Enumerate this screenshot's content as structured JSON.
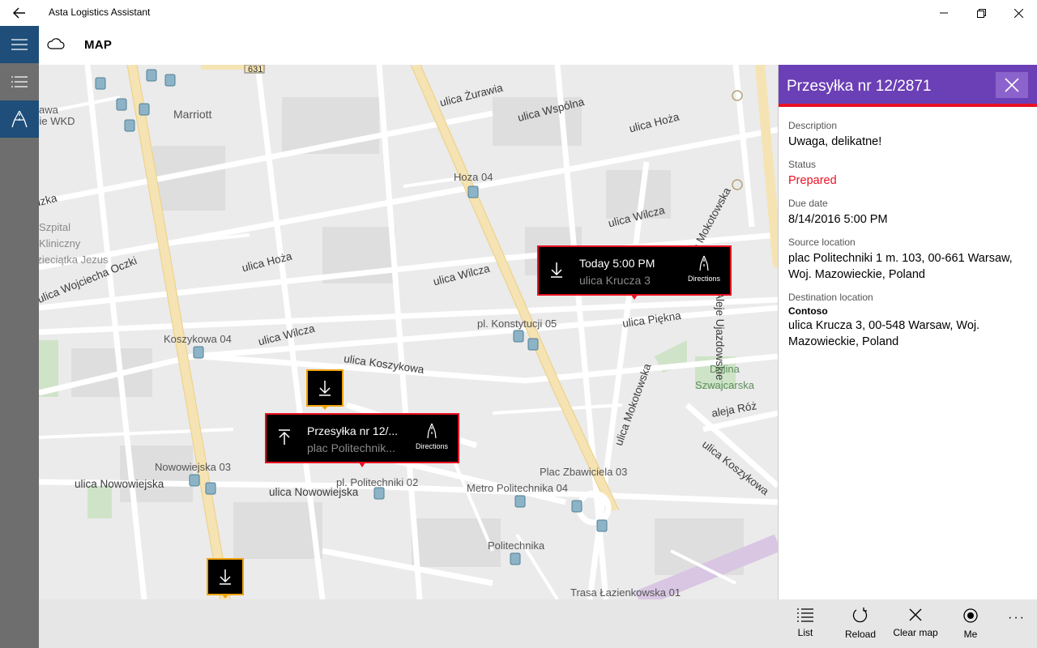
{
  "window": {
    "title": "Asta Logistics Assistant"
  },
  "header": {
    "page_title": "MAP"
  },
  "map": {
    "labels": {
      "marriott": "Marriott",
      "hoza04": "Hoza 04",
      "ulica_zurawia": "ulica Żurawia",
      "ulica_wspolna": "ulica Wspólna",
      "ulica_hoza_right": "ulica Hoża",
      "ulica_wilcza_right": "ulica Wilcza",
      "ulica_hoza_left": "ulica Hoża",
      "ulica_wilcza_mid": "ulica Wilcza",
      "ulica_wilcza_low": "ulica Wilcza",
      "koszykowa04": "Koszykowa 04",
      "ulica_koszykowa": "ulica Koszykowa",
      "pl_konstytucji": "pl. Konstytucji 05",
      "ulica_piekna": "ulica Piękna",
      "ulica_mokotowska_top": "ulica Mokotowska",
      "ulica_mokotowska_low": "ulica Mokotowska",
      "aleje_ujazdowskie": "Aleje Ujazdowskie",
      "dolina": "Dolina",
      "szwajcarska": "Szwajcarska",
      "aleja_roz": "aleja Róż",
      "ulica_koszykowa_right": "ulica Koszykowa",
      "nowowiejska03": "Nowowiejska 03",
      "ulica_nowowiejska_left": "ulica Nowowiejska",
      "ulica_nowowiejska_mid": "ulica Nowowiejska",
      "pl_politechniki": "pl. Politechniki 02",
      "plac_zbawiciela": "Plac Zbawiciela 03",
      "metro_politechnika": "Metro Politechnika 04",
      "politechnika": "Politechnika",
      "trasa_lazienkowska": "Trasa Łazienkowska 01",
      "wojciecha_oczki": "ulica Wojciecha Oczki",
      "szpital": "Szpital",
      "kliniczny": "Kliniczny",
      "dzieciatka": "Dzieciątka Jezus",
      "dzka": "dzka",
      "awa": "awa",
      "wkd": "cie WKD",
      "route_631": "631"
    },
    "callouts": [
      {
        "title": "Today 5:00 PM",
        "subtitle": "ulica Krucza 3",
        "directions_label": "Directions"
      },
      {
        "title": "Przesyłka nr 12/...",
        "subtitle": "plac Politechnik...",
        "directions_label": "Directions"
      }
    ]
  },
  "detail": {
    "title": "Przesyłka nr 12/2871",
    "description_label": "Description",
    "description_value": "Uwaga, delikatne!",
    "status_label": "Status",
    "status_value": "Prepared",
    "status_color": "#e81123",
    "due_label": "Due date",
    "due_value": "8/14/2016 5:00 PM",
    "source_label": "Source location",
    "source_value": "plac Politechniki 1 m. 103, 00-661 Warsaw, Woj. Mazowieckie, Poland",
    "destination_label": "Destination location",
    "destination_name": "Contoso",
    "destination_value": "ulica Krucza 3, 00-548 Warsaw, Woj. Mazowieckie, Poland",
    "header_color": "#6b3fb5"
  },
  "commands": {
    "list": "List",
    "reload": "Reload",
    "clear_map": "Clear map",
    "me": "Me",
    "more": "···"
  },
  "icons": {
    "back": "back-arrow-icon",
    "minimize": "minimize-icon",
    "restore": "restore-icon",
    "close": "close-icon",
    "hamburger": "hamburger-icon",
    "list": "list-icon",
    "route": "route-icon",
    "cloud": "cloud-icon"
  }
}
